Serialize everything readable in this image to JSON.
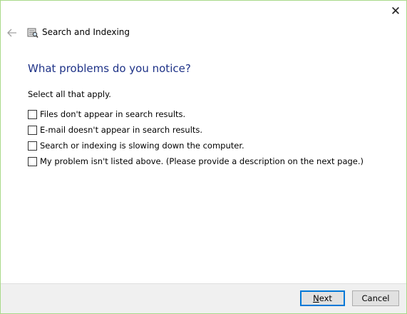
{
  "window": {
    "title": "Search and Indexing",
    "close_icon": "close-icon",
    "back_icon": "back-arrow-icon",
    "app_icon": "search-indexing-icon",
    "border_color": "#a9d98a"
  },
  "main": {
    "heading": "What problems do you notice?",
    "heading_color": "#1e3287",
    "instruction": "Select all that apply.",
    "options": [
      {
        "label": "Files don't appear in search results.",
        "checked": false
      },
      {
        "label": "E-mail doesn't appear in search results.",
        "checked": false
      },
      {
        "label": "Search or indexing is slowing down the computer.",
        "checked": false
      },
      {
        "label": "My problem isn't listed above. (Please provide a description on the next page.)",
        "checked": false
      }
    ]
  },
  "footer": {
    "next_mnemonic": "N",
    "next_rest": "ext",
    "cancel_label": "Cancel",
    "default_button_color": "#0078d7"
  }
}
